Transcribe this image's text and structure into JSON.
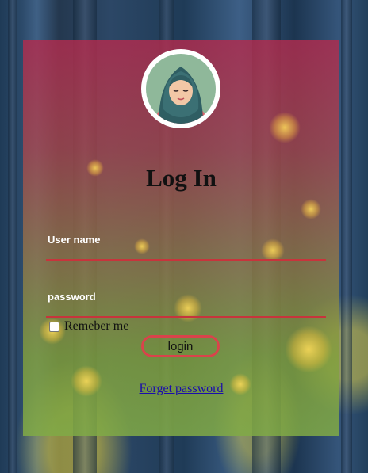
{
  "page": {
    "title": "Log In"
  },
  "avatar": {
    "icon": "user-avatar-icon"
  },
  "form": {
    "username_label": "User name",
    "username_value": "",
    "password_label": "password",
    "password_value": "",
    "remember_label": "Remeber me",
    "remember_checked": false,
    "login_label": "login",
    "forgot_label": "Forget password"
  },
  "colors": {
    "card_top": "#b22b4e",
    "card_bottom": "#80aa46",
    "accent": "#d9434b",
    "link": "#1a0dab"
  }
}
